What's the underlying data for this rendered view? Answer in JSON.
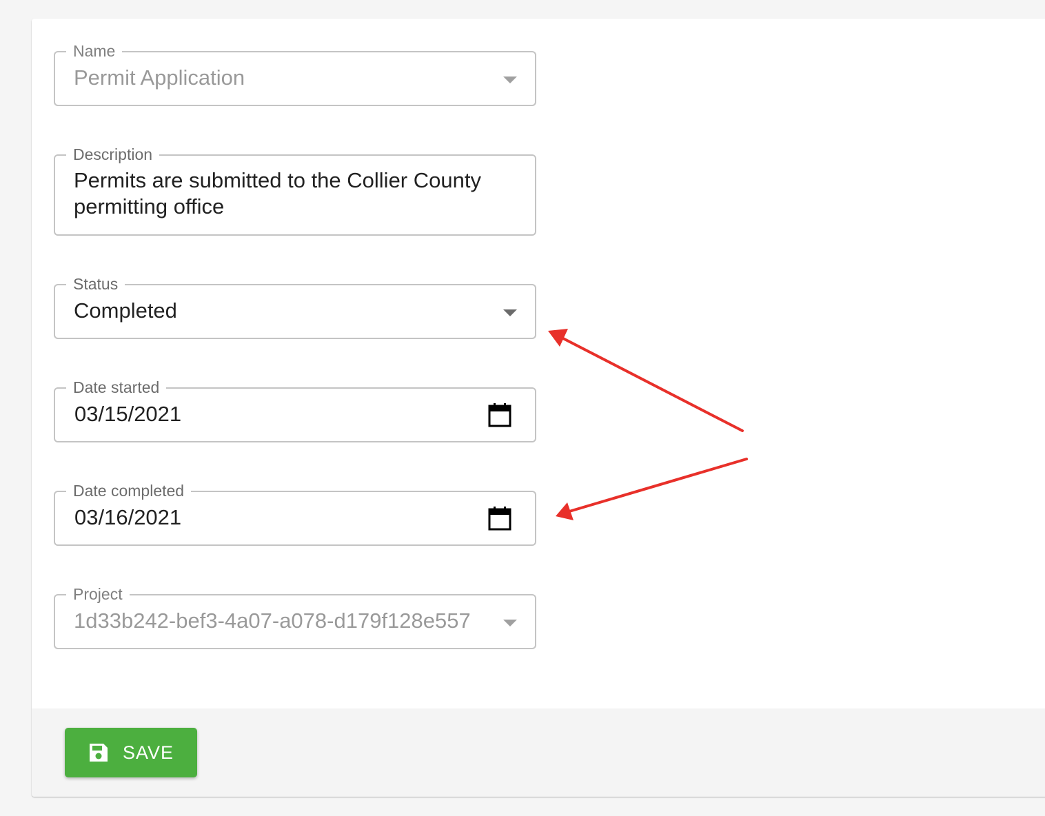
{
  "form": {
    "name": {
      "label": "Name",
      "value": "Permit Application"
    },
    "description": {
      "label": "Description",
      "value_line1": "Permits are submitted to the Collier County",
      "value_line2": "permitting office"
    },
    "status": {
      "label": "Status",
      "value": "Completed"
    },
    "date_started": {
      "label": "Date started",
      "value": "03/15/2021"
    },
    "date_completed": {
      "label": "Date completed",
      "value": "03/16/2021"
    },
    "project": {
      "label": "Project",
      "value": "1d33b242-bef3-4a07-a078-d179f128e557"
    }
  },
  "footer": {
    "save_label": "SAVE",
    "save_icon": "floppy-disk-icon"
  },
  "colors": {
    "accent": "#4caf3f",
    "annotation_arrow": "#e8302a",
    "border": "#c4c4c4",
    "footer_bg": "#f4f4f4"
  }
}
